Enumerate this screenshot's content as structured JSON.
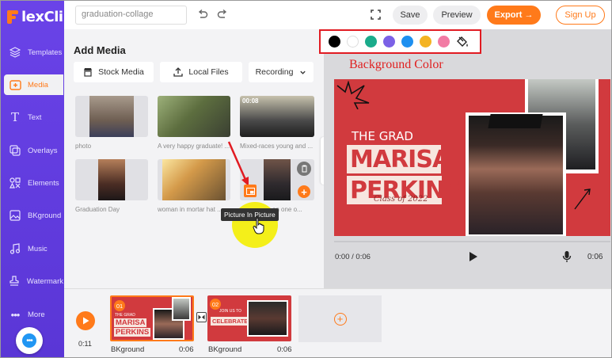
{
  "app": {
    "logo_text": "FlexClip",
    "brand_color": "#6a43e8",
    "accent_color": "#ff7a1a"
  },
  "sidebar": {
    "items": [
      {
        "label": "Templates",
        "icon": "layers-icon"
      },
      {
        "label": "Media",
        "icon": "media-folder-icon",
        "active": true
      },
      {
        "label": "Text",
        "icon": "text-icon"
      },
      {
        "label": "Overlays",
        "icon": "overlays-icon"
      },
      {
        "label": "Elements",
        "icon": "elements-icon"
      },
      {
        "label": "BKground",
        "icon": "background-icon"
      },
      {
        "label": "Music",
        "icon": "music-icon"
      },
      {
        "label": "Watermark",
        "icon": "watermark-icon"
      },
      {
        "label": "More",
        "icon": "more-dots-icon"
      }
    ]
  },
  "topbar": {
    "project_name": "graduation-collage",
    "save_label": "Save",
    "preview_label": "Preview",
    "export_label": "Export →",
    "signup_label": "Sign Up"
  },
  "media_panel": {
    "title": "Add Media",
    "stock_media_label": "Stock Media",
    "local_files_label": "Local Files",
    "recording_label": "Recording",
    "items": [
      {
        "caption": "photo",
        "duration": ""
      },
      {
        "caption": "A very happy graduate! ...",
        "duration": ""
      },
      {
        "caption": "Mixed-races young and ...",
        "duration": "00:08"
      },
      {
        "caption": "Graduation Day",
        "duration": ""
      },
      {
        "caption": "woman in mortar hat ...",
        "duration": ""
      },
      {
        "caption": "... on one o...",
        "duration": ""
      }
    ],
    "tooltip": "Picture In Picture"
  },
  "background_colors": {
    "swatches": [
      "#000000",
      "#ffffff",
      "#1aab8b",
      "#7b61e6",
      "#1e90f0",
      "#f4b322",
      "#f27ba4"
    ],
    "label": "Background Color"
  },
  "canvas": {
    "background": "#d13a3e",
    "subtitle": "THE GRAD",
    "first_name": "MARISA",
    "last_name": "PERKINS",
    "class_of": "Class of 2022"
  },
  "player": {
    "current_time": "0:00 / 0:06",
    "duration": "0:06"
  },
  "timeline": {
    "current": "0:11",
    "clips": [
      {
        "number": "01",
        "label": "BKground",
        "duration": "0:06",
        "text1": "THE GRAD",
        "text2": "MARISA",
        "text3": "PERKINS"
      },
      {
        "number": "02",
        "label": "BKground",
        "duration": "0:06",
        "text1": "JOIN US TO",
        "text2": "CELEBRATE"
      }
    ]
  }
}
